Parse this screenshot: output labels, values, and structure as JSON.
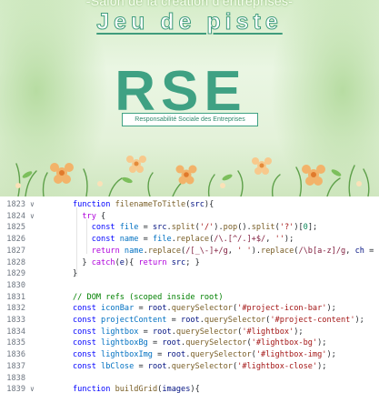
{
  "poster": {
    "subtitle": "-Salon de la création d'entreprises-",
    "title": "Jeu de piste",
    "logo_text": "RSE",
    "logo_caption": "Responsabilité Sociale des Entreprises"
  },
  "editor": {
    "lines": [
      {
        "num": "1823",
        "fold": "∨",
        "tokens": [
          {
            "t": "function ",
            "c": "kw"
          },
          {
            "t": "filenameToTitle",
            "c": "fn"
          },
          {
            "t": "(",
            "c": ""
          },
          {
            "t": "src",
            "c": "var"
          },
          {
            "t": "){",
            "c": ""
          }
        ]
      },
      {
        "num": "1824",
        "fold": "∨",
        "tokens": [
          {
            "t": "  try",
            "c": "kw2"
          },
          {
            "t": " {",
            "c": ""
          }
        ]
      },
      {
        "num": "1825",
        "fold": "",
        "tokens": [
          {
            "t": "    const ",
            "c": "kw"
          },
          {
            "t": "file",
            "c": "cst"
          },
          {
            "t": " = ",
            "c": ""
          },
          {
            "t": "src",
            "c": "var"
          },
          {
            "t": ".",
            "c": ""
          },
          {
            "t": "split",
            "c": "fn"
          },
          {
            "t": "(",
            "c": ""
          },
          {
            "t": "'/'",
            "c": "str"
          },
          {
            "t": ").",
            "c": ""
          },
          {
            "t": "pop",
            "c": "fn"
          },
          {
            "t": "().",
            "c": ""
          },
          {
            "t": "split",
            "c": "fn"
          },
          {
            "t": "(",
            "c": ""
          },
          {
            "t": "'?'",
            "c": "str"
          },
          {
            "t": ")[",
            "c": ""
          },
          {
            "t": "0",
            "c": "num"
          },
          {
            "t": "];",
            "c": ""
          }
        ]
      },
      {
        "num": "1826",
        "fold": "",
        "tokens": [
          {
            "t": "    const ",
            "c": "kw"
          },
          {
            "t": "name",
            "c": "cst"
          },
          {
            "t": " = ",
            "c": ""
          },
          {
            "t": "file",
            "c": "cst"
          },
          {
            "t": ".",
            "c": ""
          },
          {
            "t": "replace",
            "c": "fn"
          },
          {
            "t": "(",
            "c": ""
          },
          {
            "t": "/\\.[^/.]+$/",
            "c": "rx"
          },
          {
            "t": ", ",
            "c": ""
          },
          {
            "t": "''",
            "c": "str"
          },
          {
            "t": ");",
            "c": ""
          }
        ]
      },
      {
        "num": "1827",
        "fold": "",
        "tokens": [
          {
            "t": "    return ",
            "c": "kw2"
          },
          {
            "t": "name",
            "c": "cst"
          },
          {
            "t": ".",
            "c": ""
          },
          {
            "t": "replace",
            "c": "fn"
          },
          {
            "t": "(",
            "c": ""
          },
          {
            "t": "/[_\\-]+/g",
            "c": "rx"
          },
          {
            "t": ", ",
            "c": ""
          },
          {
            "t": "' '",
            "c": "str"
          },
          {
            "t": ").",
            "c": ""
          },
          {
            "t": "replace",
            "c": "fn"
          },
          {
            "t": "(",
            "c": ""
          },
          {
            "t": "/\\b[a-z]/g",
            "c": "rx"
          },
          {
            "t": ", ",
            "c": ""
          },
          {
            "t": "ch",
            "c": "var"
          },
          {
            "t": " =",
            "c": ""
          }
        ]
      },
      {
        "num": "1828",
        "fold": "",
        "tokens": [
          {
            "t": "  } ",
            "c": ""
          },
          {
            "t": "catch",
            "c": "kw2"
          },
          {
            "t": "(",
            "c": ""
          },
          {
            "t": "e",
            "c": "var"
          },
          {
            "t": "){ ",
            "c": ""
          },
          {
            "t": "return ",
            "c": "kw2"
          },
          {
            "t": "src",
            "c": "var"
          },
          {
            "t": "; }",
            "c": ""
          }
        ]
      },
      {
        "num": "1829",
        "fold": "",
        "tokens": [
          {
            "t": "}",
            "c": ""
          }
        ]
      },
      {
        "num": "1830",
        "fold": "",
        "tokens": []
      },
      {
        "num": "1831",
        "fold": "",
        "tokens": [
          {
            "t": "// DOM refs (scoped inside root)",
            "c": "cm"
          }
        ]
      },
      {
        "num": "1832",
        "fold": "",
        "tokens": [
          {
            "t": "const ",
            "c": "kw"
          },
          {
            "t": "iconBar",
            "c": "cst"
          },
          {
            "t": " = ",
            "c": ""
          },
          {
            "t": "root",
            "c": "var"
          },
          {
            "t": ".",
            "c": ""
          },
          {
            "t": "querySelector",
            "c": "fn"
          },
          {
            "t": "(",
            "c": ""
          },
          {
            "t": "'#project-icon-bar'",
            "c": "str"
          },
          {
            "t": ");",
            "c": ""
          }
        ]
      },
      {
        "num": "1833",
        "fold": "",
        "tokens": [
          {
            "t": "const ",
            "c": "kw"
          },
          {
            "t": "projectContent",
            "c": "cst"
          },
          {
            "t": " = ",
            "c": ""
          },
          {
            "t": "root",
            "c": "var"
          },
          {
            "t": ".",
            "c": ""
          },
          {
            "t": "querySelector",
            "c": "fn"
          },
          {
            "t": "(",
            "c": ""
          },
          {
            "t": "'#project-content'",
            "c": "str"
          },
          {
            "t": ");",
            "c": ""
          }
        ]
      },
      {
        "num": "1834",
        "fold": "",
        "tokens": [
          {
            "t": "const ",
            "c": "kw"
          },
          {
            "t": "lightbox",
            "c": "cst"
          },
          {
            "t": " = ",
            "c": ""
          },
          {
            "t": "root",
            "c": "var"
          },
          {
            "t": ".",
            "c": ""
          },
          {
            "t": "querySelector",
            "c": "fn"
          },
          {
            "t": "(",
            "c": ""
          },
          {
            "t": "'#lightbox'",
            "c": "str"
          },
          {
            "t": ");",
            "c": ""
          }
        ]
      },
      {
        "num": "1835",
        "fold": "",
        "tokens": [
          {
            "t": "const ",
            "c": "kw"
          },
          {
            "t": "lightboxBg",
            "c": "cst"
          },
          {
            "t": " = ",
            "c": ""
          },
          {
            "t": "root",
            "c": "var"
          },
          {
            "t": ".",
            "c": ""
          },
          {
            "t": "querySelector",
            "c": "fn"
          },
          {
            "t": "(",
            "c": ""
          },
          {
            "t": "'#lightbox-bg'",
            "c": "str"
          },
          {
            "t": ");",
            "c": ""
          }
        ]
      },
      {
        "num": "1836",
        "fold": "",
        "tokens": [
          {
            "t": "const ",
            "c": "kw"
          },
          {
            "t": "lightboxImg",
            "c": "cst"
          },
          {
            "t": " = ",
            "c": ""
          },
          {
            "t": "root",
            "c": "var"
          },
          {
            "t": ".",
            "c": ""
          },
          {
            "t": "querySelector",
            "c": "fn"
          },
          {
            "t": "(",
            "c": ""
          },
          {
            "t": "'#lightbox-img'",
            "c": "str"
          },
          {
            "t": ");",
            "c": ""
          }
        ]
      },
      {
        "num": "1837",
        "fold": "",
        "tokens": [
          {
            "t": "const ",
            "c": "kw"
          },
          {
            "t": "lbClose",
            "c": "cst"
          },
          {
            "t": " = ",
            "c": ""
          },
          {
            "t": "root",
            "c": "var"
          },
          {
            "t": ".",
            "c": ""
          },
          {
            "t": "querySelector",
            "c": "fn"
          },
          {
            "t": "(",
            "c": ""
          },
          {
            "t": "'#lightbox-close'",
            "c": "str"
          },
          {
            "t": ");",
            "c": ""
          }
        ]
      },
      {
        "num": "1838",
        "fold": "",
        "tokens": []
      },
      {
        "num": "1839",
        "fold": "∨",
        "tokens": [
          {
            "t": "function ",
            "c": "kw"
          },
          {
            "t": "buildGrid",
            "c": "fn"
          },
          {
            "t": "(",
            "c": ""
          },
          {
            "t": "images",
            "c": "var"
          },
          {
            "t": "){",
            "c": ""
          }
        ]
      }
    ]
  }
}
